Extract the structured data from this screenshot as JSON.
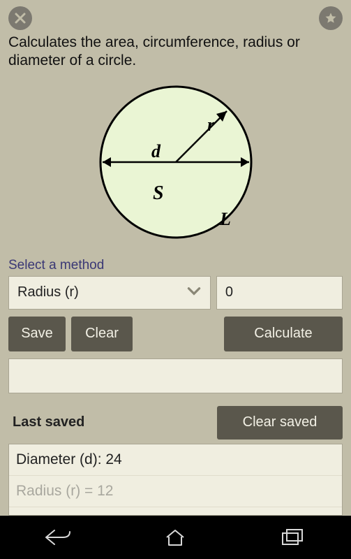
{
  "description": "Calculates the area, circumference, radius or diameter of a circle.",
  "diagram": {
    "r": "r",
    "d": "d",
    "s": "S",
    "l": "L"
  },
  "method": {
    "label": "Select a method",
    "selected": "Radius (r)",
    "value": "0"
  },
  "buttons": {
    "save": "Save",
    "clear": "Clear",
    "calculate": "Calculate",
    "clear_saved": "Clear saved"
  },
  "saved": {
    "title": "Last saved",
    "items": [
      "Diameter (d): 24",
      "Radius (r) = 12"
    ]
  }
}
